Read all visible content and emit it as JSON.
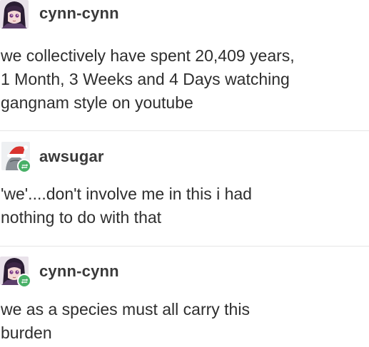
{
  "posts": [
    {
      "username": "cynn-cynn",
      "avatar_icon": "anime-girl-avatar-icon",
      "reblog": false,
      "body": "we collectively have spent 20,409 years,\n1 Month, 3 Weeks and 4 Days watching\ngangnam style on youtube"
    },
    {
      "username": "awsugar",
      "avatar_icon": "santa-hat-avatar-icon",
      "reblog": true,
      "body": "'we'....don't involve me in this i had\nnothing to do with that"
    },
    {
      "username": "cynn-cynn",
      "avatar_icon": "anime-girl-avatar-icon",
      "reblog": true,
      "body": "we as a species must all carry this\nburden"
    }
  ],
  "colors": {
    "reblog_green": "#48b067",
    "text": "#2e2e2e",
    "divider": "#e6e6e6"
  }
}
